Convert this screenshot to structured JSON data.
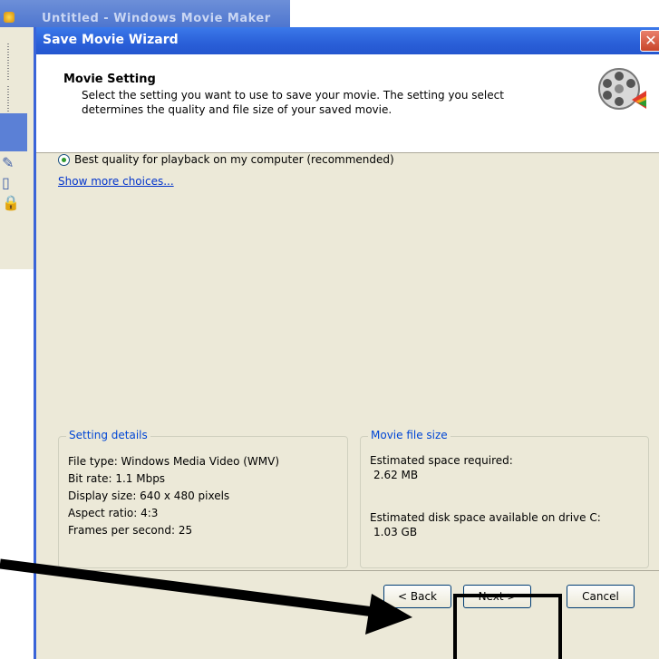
{
  "background_app": {
    "title": "Untitled - Windows Movie Maker"
  },
  "wizard": {
    "title": "Save Movie Wizard",
    "header": {
      "title": "Movie Setting",
      "description": "Select the setting you want to use to save your movie. The setting you select determines the quality and file size of your saved movie."
    },
    "option_label": "Best quality for playback on my computer (recommended)",
    "show_more": "Show more choices...",
    "details": {
      "label": "Setting details",
      "lines": [
        "File type: Windows Media Video (WMV)",
        "Bit rate: 1.1 Mbps",
        "Display size: 640 x 480 pixels",
        "Aspect ratio: 4:3",
        "Frames per second: 25"
      ]
    },
    "file_size": {
      "label": "Movie file size",
      "space_required_label": "Estimated space required:",
      "space_required_value": "2.62 MB",
      "disk_space_label": "Estimated disk space available on drive C:",
      "disk_space_value": "1.03 GB"
    },
    "buttons": {
      "back": "< Back",
      "next": "Next >",
      "cancel": "Cancel"
    }
  },
  "colors": {
    "titlebar": "#2a5fd8",
    "face": "#ECE9D8",
    "link": "#0033cc",
    "group_label": "#0046D5"
  }
}
